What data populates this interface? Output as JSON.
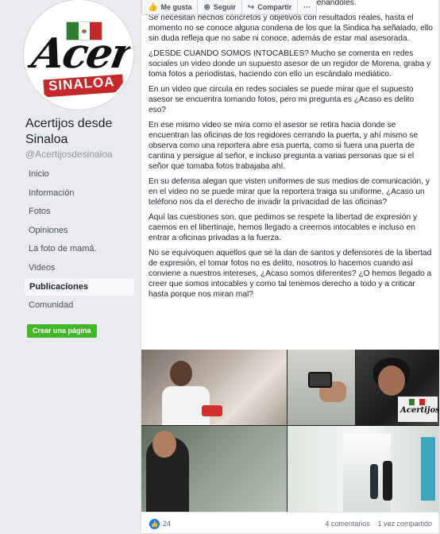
{
  "page": {
    "name": "Acertijos desde Sinaloa",
    "handle": "@Acertijosdesinaloa",
    "logo_text": "Acertijos",
    "logo_band_text": "SINALOA"
  },
  "nav": {
    "items": [
      {
        "label": "Inicio"
      },
      {
        "label": "Información"
      },
      {
        "label": "Fotos"
      },
      {
        "label": "Opiniones"
      },
      {
        "label": "La foto de mamá."
      },
      {
        "label": "Videos"
      },
      {
        "label": "Publicaciones",
        "active": true
      },
      {
        "label": "Comunidad"
      }
    ],
    "create_page_label": "Crear una página"
  },
  "actions": {
    "like": "Me gusta",
    "follow": "Seguir",
    "share": "Compartir",
    "more": "···"
  },
  "post": {
    "paragraphs": [
      "repartiendo culpas, señalando nombres y condenándoles.",
      "Se necesitan hechos concretos y objetivos con resultados reales, hasta el momento no se conoce alguna condena de los que la Sindica ha señalado, ello sin duda refleja que no sabe ni conoce, además de estar mal asesorada.",
      "¿DESDE CUANDO SOMOS INTOCABLES? Mucho se comenta en redes sociales un video donde un supuesto asesor de un regidor de Morena, graba y toma fotos a periodistas, haciendo con ello un escándalo mediático.",
      "En un video que circula en redes sociales se puede mirar que el supuesto asesor se encuentra tomando fotos, pero mi pregunta es ¿Acaso es delito eso?",
      "En ese mismo video se mira como el asesor se retira hacia donde se encuentran las oficinas de los regidores cerrando la puerta, y ahí mismo se observa como una reportera abre esa puerta, como si fuera una puerta de cantina y persigue al señor, e incluso pregunta a varias personas que si el señor que tomaba fotos trabajaba ahí.",
      "En su defensa alegan que visten uniformes de sus medios de comunicación, y en el video no se puede mirar que la reportera traiga su uniforme, ¿Acaso un teléfono nos da el derecho de invadir la privacidad de las oficinas?",
      "Aquí las cuestiones son, que pedimos se respete la libertad de expresión y caemos en el libertinaje, hemos llegado a creernos intocables e incluso en entrar a oficinas privadas a la fuerza.",
      "No se equivoquen aquellos que se la dan de santos y defensores de la libertad de expresión, el tomar fotos no es delito, nosotros lo hacemos cuando así conviene a nuestros intereses, ¿Acaso somos diferentes? ¿O hemos llegado a creer que somos intocables y como tal tenemos derecho a todo y a criticar hasta porque nos miran mal?"
    ],
    "photo_watermark": "Acertijos",
    "like_count": "24",
    "comments": "4 comentarios",
    "shares": "1 vez compartido"
  },
  "colors": {
    "accent": "#4267b2",
    "create_button": "#42b72a",
    "brand_red": "#c62828"
  }
}
